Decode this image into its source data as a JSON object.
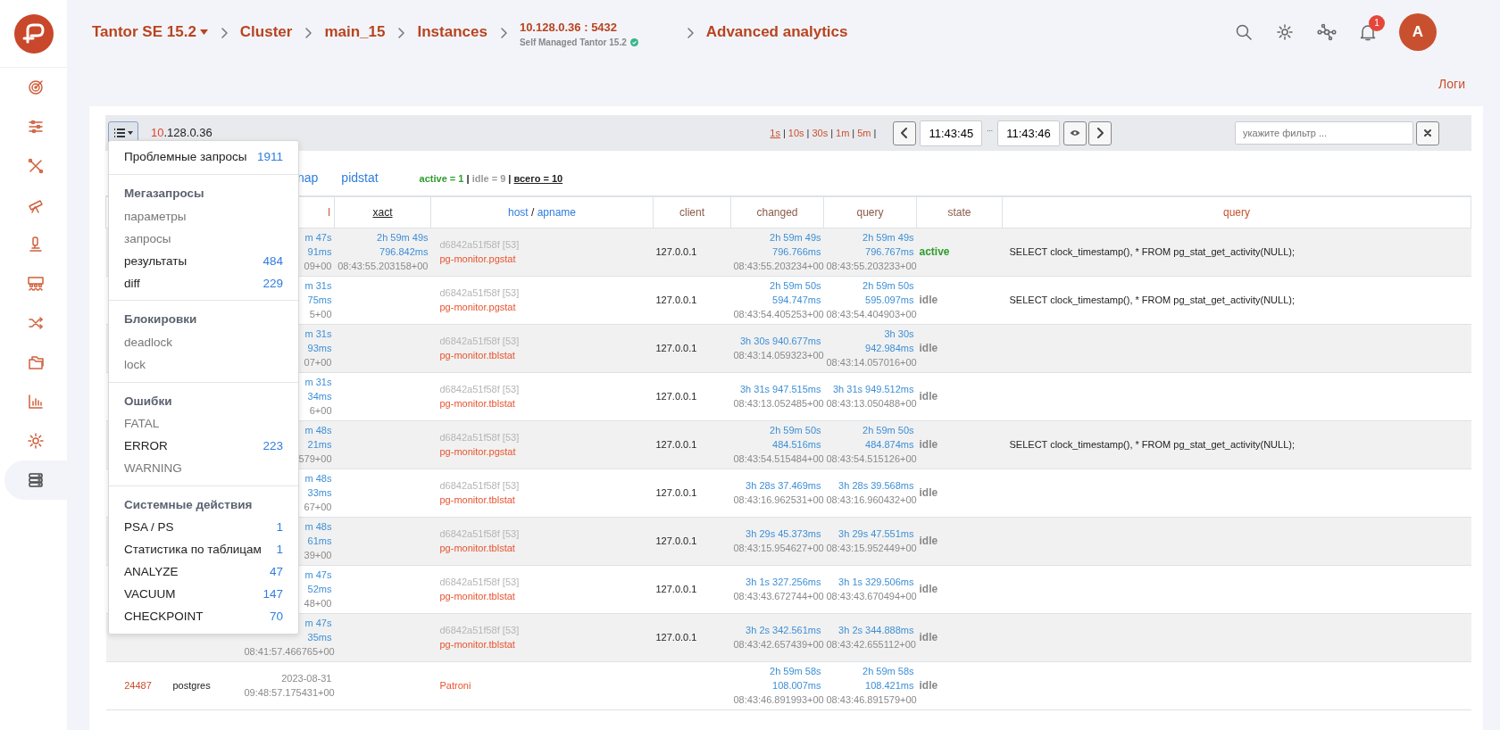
{
  "sidebar": {
    "items": [
      {
        "selected": false
      },
      {
        "selected": false
      },
      {
        "selected": false
      },
      {
        "selected": false
      },
      {
        "selected": false
      },
      {
        "selected": false
      },
      {
        "selected": false
      },
      {
        "selected": false
      },
      {
        "selected": false
      },
      {
        "selected": false
      },
      {
        "selected": true
      }
    ]
  },
  "header": {
    "breadcrumbs": [
      {
        "kind": "dropdown",
        "label": "Tantor SE 15.2"
      },
      {
        "kind": "link",
        "label": "Cluster"
      },
      {
        "kind": "link",
        "label": "main_15"
      },
      {
        "kind": "link",
        "label": "Instances"
      },
      {
        "kind": "instance",
        "label": "10.128.0.36 : 5432",
        "subtitle": "Self Managed Tantor 15.2"
      },
      {
        "kind": "current",
        "label": "Advanced analytics"
      }
    ],
    "notifications": "1",
    "avatar": "A"
  },
  "logs_link": "Логи",
  "toolbar": {
    "host_parts": [
      "10",
      ".128.0.36"
    ],
    "intervals": [
      {
        "label": "1s",
        "selected": true
      },
      {
        "label": "10s",
        "selected": false
      },
      {
        "label": "30s",
        "selected": false
      },
      {
        "label": "1m",
        "selected": false
      },
      {
        "label": "5m",
        "selected": false
      }
    ],
    "interval_separator": "|",
    "from": "11:43:45",
    "range_separator": "...",
    "to": "11:43:46",
    "filter_placeholder": "укажите фильтр ..."
  },
  "menu": {
    "items": [
      {
        "kind": "item",
        "label": "Проблемные запросы",
        "count": "1911",
        "disabled": false
      },
      {
        "kind": "divider"
      },
      {
        "kind": "header",
        "label": "Мегазапросы"
      },
      {
        "kind": "item",
        "label": "параметры",
        "disabled": true
      },
      {
        "kind": "item",
        "label": "запросы",
        "disabled": true
      },
      {
        "kind": "item",
        "label": "результаты",
        "count": "484",
        "disabled": false
      },
      {
        "kind": "item",
        "label": "diff",
        "count": "229",
        "disabled": false
      },
      {
        "kind": "divider"
      },
      {
        "kind": "header",
        "label": "Блокировки"
      },
      {
        "kind": "item",
        "label": "deadlock",
        "disabled": true
      },
      {
        "kind": "item",
        "label": "lock",
        "disabled": true
      },
      {
        "kind": "divider"
      },
      {
        "kind": "header",
        "label": "Ошибки"
      },
      {
        "kind": "item",
        "label": "FATAL",
        "disabled": true
      },
      {
        "kind": "item",
        "label": "ERROR",
        "count": "223",
        "disabled": false
      },
      {
        "kind": "item",
        "label": "WARNING",
        "disabled": true
      },
      {
        "kind": "divider"
      },
      {
        "kind": "header",
        "label": "Системные действия"
      },
      {
        "kind": "item",
        "label": "PSA / PS",
        "count": "1",
        "disabled": false
      },
      {
        "kind": "item",
        "label": "Статистика по таблицам",
        "count": "1",
        "disabled": false
      },
      {
        "kind": "item",
        "label": "ANALYZE",
        "count": "47",
        "disabled": false
      },
      {
        "kind": "item",
        "label": "VACUUM",
        "count": "147",
        "disabled": false
      },
      {
        "kind": "item",
        "label": "CHECKPOINT",
        "count": "70",
        "disabled": false
      }
    ]
  },
  "tabs": [
    {
      "label": "nap",
      "selected": false
    },
    {
      "label": "pidstat",
      "selected": false
    }
  ],
  "session_counts": [
    {
      "kind": "active",
      "text": "active = 1"
    },
    {
      "kind": "sep",
      "text": "|"
    },
    {
      "kind": "idle",
      "text": "idle = 9"
    },
    {
      "kind": "sep",
      "text": "|"
    },
    {
      "kind": "total",
      "text": "всего = 10"
    }
  ],
  "table": {
    "columns": [
      {
        "kind": "fragment",
        "label": "l"
      },
      {
        "kind": "sorted",
        "label": "xact"
      },
      {
        "kind": "pair",
        "labels": [
          "host",
          "apname"
        ],
        "separator": "/"
      },
      {
        "kind": "plain",
        "label": "client"
      },
      {
        "kind": "plain",
        "label": "changed"
      },
      {
        "kind": "plain",
        "label": "query"
      },
      {
        "kind": "plain",
        "label": "state"
      },
      {
        "kind": "wide",
        "label": "query"
      }
    ],
    "rows": [
      {
        "started": {
          "kind": "duration",
          "lines": [
            "m 47s",
            "91ms",
            "09+00"
          ]
        },
        "xact": [
          "2h 59m 49s",
          "796.842ms",
          "08:43:55.203158+00"
        ],
        "host": "d6842a51f58f [53]",
        "app": "pg-monitor.pgstat",
        "client": "127.0.0.1",
        "changed": [
          "2h 59m 49s",
          "796.766ms",
          "08:43:55.203234+00"
        ],
        "query_age": [
          "2h 59m 49s",
          "796.767ms",
          "08:43:55.203233+00"
        ],
        "state": "active",
        "active": true,
        "query": "SELECT clock_timestamp(), * FROM pg_stat_get_activity(NULL);"
      },
      {
        "started": {
          "kind": "duration",
          "lines": [
            "m 31s",
            "75ms",
            "5+00"
          ]
        },
        "host": "d6842a51f58f [53]",
        "app": "pg-monitor.pgstat",
        "client": "127.0.0.1",
        "changed": [
          "2h 59m 50s",
          "594.747ms",
          "08:43:54.405253+00"
        ],
        "query_age": [
          "2h 59m 50s",
          "595.097ms",
          "08:43:54.404903+00"
        ],
        "state": "idle",
        "active": false,
        "query": "SELECT clock_timestamp(), * FROM pg_stat_get_activity(NULL);"
      },
      {
        "started": {
          "kind": "duration",
          "lines": [
            "m 31s",
            "93ms",
            "07+00"
          ]
        },
        "host": "d6842a51f58f [53]",
        "app": "pg-monitor.tblstat",
        "client": "127.0.0.1",
        "changed": [
          "3h 30s 940.677ms",
          "08:43:14.059323+00"
        ],
        "query_age": [
          "3h 30s",
          "942.984ms",
          "08:43:14.057016+00"
        ],
        "state": "idle",
        "active": false
      },
      {
        "started": {
          "kind": "duration",
          "lines": [
            "m 31s",
            "34ms",
            "6+00"
          ]
        },
        "host": "d6842a51f58f [53]",
        "app": "pg-monitor.tblstat",
        "client": "127.0.0.1",
        "changed": [
          "3h 31s 947.515ms",
          "08:43:13.052485+00"
        ],
        "query_age": [
          "3h 31s 949.512ms",
          "08:43:13.050488+00"
        ],
        "state": "idle",
        "active": false
      },
      {
        "started": {
          "kind": "duration",
          "lines": [
            "m 48s",
            "21ms",
            "579+00"
          ]
        },
        "host": "d6842a51f58f [53]",
        "app": "pg-monitor.pgstat",
        "client": "127.0.0.1",
        "changed": [
          "2h 59m 50s",
          "484.516ms",
          "08:43:54.515484+00"
        ],
        "query_age": [
          "2h 59m 50s",
          "484.874ms",
          "08:43:54.515126+00"
        ],
        "state": "idle",
        "active": false,
        "query": "SELECT clock_timestamp(), * FROM pg_stat_get_activity(NULL);"
      },
      {
        "started": {
          "kind": "duration",
          "lines": [
            "m 48s",
            "33ms",
            "67+00"
          ]
        },
        "host": "d6842a51f58f [53]",
        "app": "pg-monitor.tblstat",
        "client": "127.0.0.1",
        "changed": [
          "3h 28s 37.469ms",
          "08:43:16.962531+00"
        ],
        "query_age": [
          "3h 28s 39.568ms",
          "08:43:16.960432+00"
        ],
        "state": "idle",
        "active": false
      },
      {
        "started": {
          "kind": "duration",
          "lines": [
            "m 48s",
            "61ms",
            "39+00"
          ]
        },
        "host": "d6842a51f58f [53]",
        "app": "pg-monitor.tblstat",
        "client": "127.0.0.1",
        "changed": [
          "3h 29s 45.373ms",
          "08:43:15.954627+00"
        ],
        "query_age": [
          "3h 29s 47.551ms",
          "08:43:15.952449+00"
        ],
        "state": "idle",
        "active": false
      },
      {
        "started": {
          "kind": "duration",
          "lines": [
            "m 47s",
            "52ms",
            "48+00"
          ]
        },
        "host": "d6842a51f58f [53]",
        "app": "pg-monitor.tblstat",
        "client": "127.0.0.1",
        "changed": [
          "3h 1s 327.256ms",
          "08:43:43.672744+00"
        ],
        "query_age": [
          "3h 1s 329.506ms",
          "08:43:43.670494+00"
        ],
        "state": "idle",
        "active": false
      },
      {
        "started": {
          "kind": "duration",
          "lines": [
            "m 47s",
            "35ms",
            "08:41:57.466765+00"
          ]
        },
        "host": "d6842a51f58f [53]",
        "app": "pg-monitor.tblstat",
        "client": "127.0.0.1",
        "changed": [
          "3h 2s 342.561ms",
          "08:43:42.657439+00"
        ],
        "query_age": [
          "3h 2s 344.888ms",
          "08:43:42.655112+00"
        ],
        "state": "idle",
        "active": false
      },
      {
        "pid": "24487",
        "user": "postgres",
        "started": {
          "kind": "date",
          "lines": [
            "2023-08-31",
            "09:48:57.175431+00"
          ]
        },
        "app": "Patroni",
        "changed": [
          "2h 59m 58s",
          "108.007ms",
          "08:43:46.891993+00"
        ],
        "query_age": [
          "2h 59m 58s",
          "108.421ms",
          "08:43:46.891579+00"
        ],
        "state": "idle",
        "active": false
      }
    ]
  }
}
